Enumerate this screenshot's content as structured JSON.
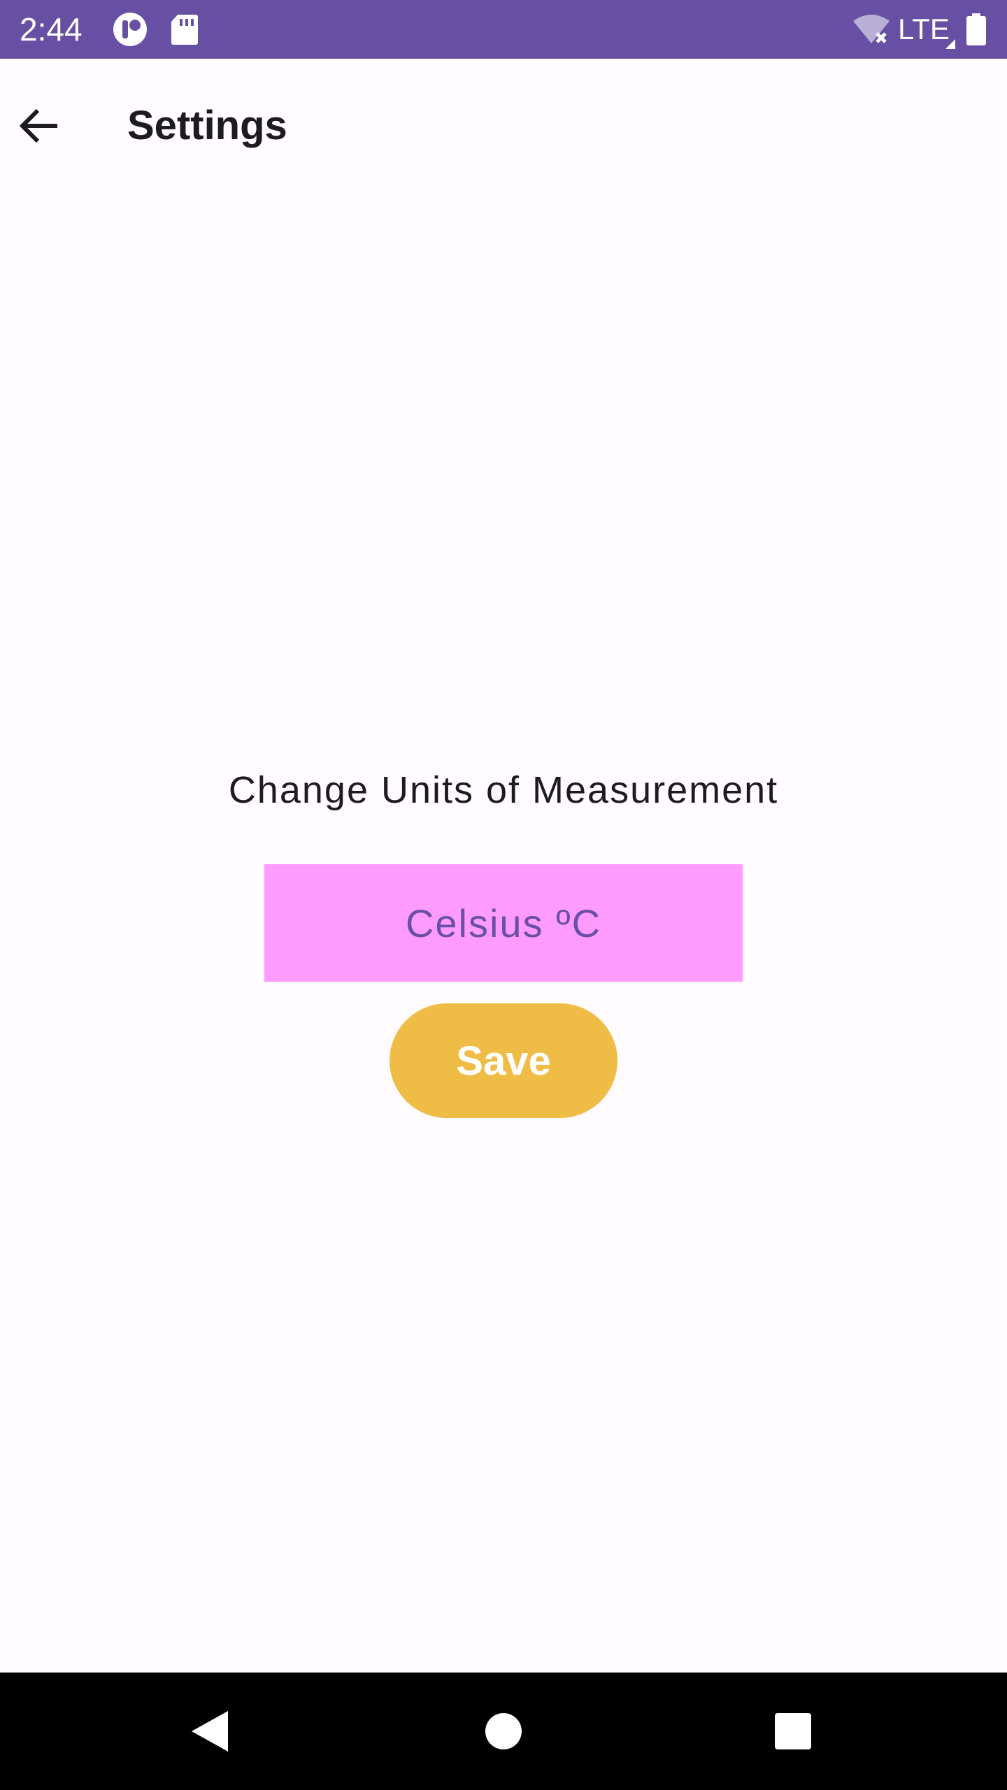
{
  "status_bar": {
    "time": "2:44",
    "network": "LTE",
    "background_color": "#6750a4",
    "icons": [
      "app-notification-icon",
      "sd-card-icon",
      "wifi-off-icon",
      "cellular-signal-icon",
      "battery-icon"
    ]
  },
  "app_bar": {
    "title": "Settings",
    "back_icon": "arrow-back-icon"
  },
  "settings": {
    "heading": "Change Units of Measurement",
    "unit_selected": "Celsius ºC",
    "save_label": "Save"
  },
  "colors": {
    "background": "#fffbfe",
    "unit_selector_bg": "#ff9bff",
    "unit_selector_text": "#6a4fa8",
    "save_button_bg": "#efbd45",
    "save_button_text": "#ffffff"
  },
  "nav_bar": {
    "buttons": [
      "back-triangle-icon",
      "home-circle-icon",
      "recents-square-icon"
    ]
  }
}
